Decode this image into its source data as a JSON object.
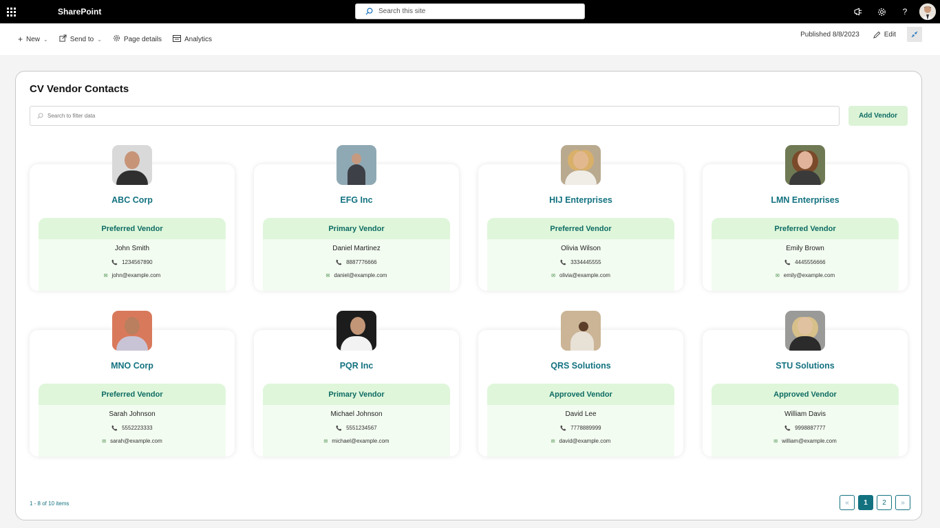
{
  "suite": {
    "app_name": "SharePoint",
    "search_placeholder": "Search this site"
  },
  "command_bar": {
    "new_label": "New",
    "send_to_label": "Send to",
    "page_details_label": "Page details",
    "analytics_label": "Analytics",
    "published_text": "Published 8/8/2023",
    "edit_label": "Edit"
  },
  "webpart": {
    "title": "CV Vendor Contacts",
    "filter_placeholder": "Search to filter data",
    "add_button_label": "Add Vendor",
    "vendors": [
      {
        "company": "ABC Corp",
        "type": "Preferred Vendor",
        "contact": "John Smith",
        "phone": "1234567890",
        "email": "john@example.com"
      },
      {
        "company": "EFG Inc",
        "type": "Primary Vendor",
        "contact": "Daniel Martinez",
        "phone": "8887776666",
        "email": "daniel@example.com"
      },
      {
        "company": "HIJ Enterprises",
        "type": "Preferred Vendor",
        "contact": "Olivia Wilson",
        "phone": "3334445555",
        "email": "olivia@example.com"
      },
      {
        "company": "LMN Enterprises",
        "type": "Preferred Vendor",
        "contact": "Emily Brown",
        "phone": "4445556666",
        "email": "emily@example.com"
      },
      {
        "company": "MNO Corp",
        "type": "Preferred Vendor",
        "contact": "Sarah Johnson",
        "phone": "5552223333",
        "email": "sarah@example.com"
      },
      {
        "company": "PQR Inc",
        "type": "Primary Vendor",
        "contact": "Michael Johnson",
        "phone": "5551234567",
        "email": "michael@example.com"
      },
      {
        "company": "QRS Solutions",
        "type": "Approved Vendor",
        "contact": "David Lee",
        "phone": "7778889999",
        "email": "david@example.com"
      },
      {
        "company": "STU Solutions",
        "type": "Approved Vendor",
        "contact": "William Davis",
        "phone": "9998887777",
        "email": "william@example.com"
      }
    ],
    "item_count_text": "1 - 8 of 10 items",
    "pagination": {
      "prev": "«",
      "pages": [
        "1",
        "2"
      ],
      "next": "»",
      "current": "1"
    }
  },
  "colors": {
    "accent": "#137280",
    "tag_bg": "#dff6da",
    "detail_bg": "#f3fcf1",
    "button_bg": "#dcf3d6"
  }
}
